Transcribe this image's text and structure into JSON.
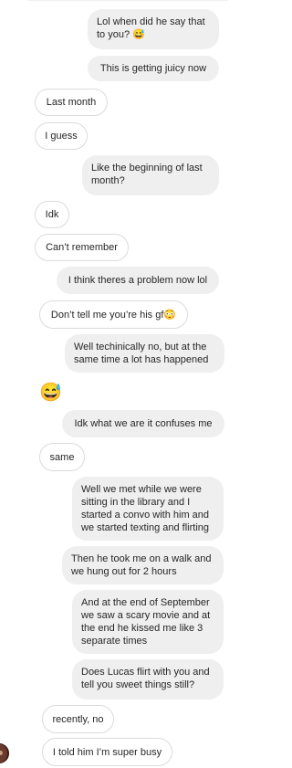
{
  "messages": [
    {
      "from": "me",
      "text": "Lol when did he say that to you? 😅"
    },
    {
      "from": "me",
      "text": "This is getting juicy now"
    },
    {
      "from": "them",
      "text": "Last month"
    },
    {
      "from": "them",
      "text": "I guess"
    },
    {
      "from": "me",
      "text": "Like the beginning of last month?"
    },
    {
      "from": "them",
      "text": "Idk"
    },
    {
      "from": "them",
      "text": "Can’t remember"
    },
    {
      "from": "me",
      "text": "I think theres a problem now lol"
    },
    {
      "from": "them",
      "text": "Don’t tell me you’re his gf😳"
    },
    {
      "from": "me",
      "text": "Well techinically no, but at the same time a lot has happened"
    },
    {
      "from": "them",
      "text": "😅"
    },
    {
      "from": "me",
      "text": "Idk what we are it confuses me"
    },
    {
      "from": "them",
      "text": "same"
    },
    {
      "from": "me",
      "text": "Well we met while we were sitting in the library and I started a convo with him and we started texting and flirting"
    },
    {
      "from": "me",
      "text": "Then he took me on a walk and we hung out for 2 hours"
    },
    {
      "from": "me",
      "text": "And at the end of September we saw a scary movie and at the end he kissed me like 3 separate times"
    },
    {
      "from": "me",
      "text": "Does Lucas flirt with you and tell you sweet things still?"
    },
    {
      "from": "them",
      "text": "recently, no"
    },
    {
      "from": "them",
      "text": "I told him I’m super busy"
    }
  ],
  "colors": {
    "sent_bg": "#efefef",
    "received_border": "#dbdbdb",
    "text": "#262626"
  }
}
